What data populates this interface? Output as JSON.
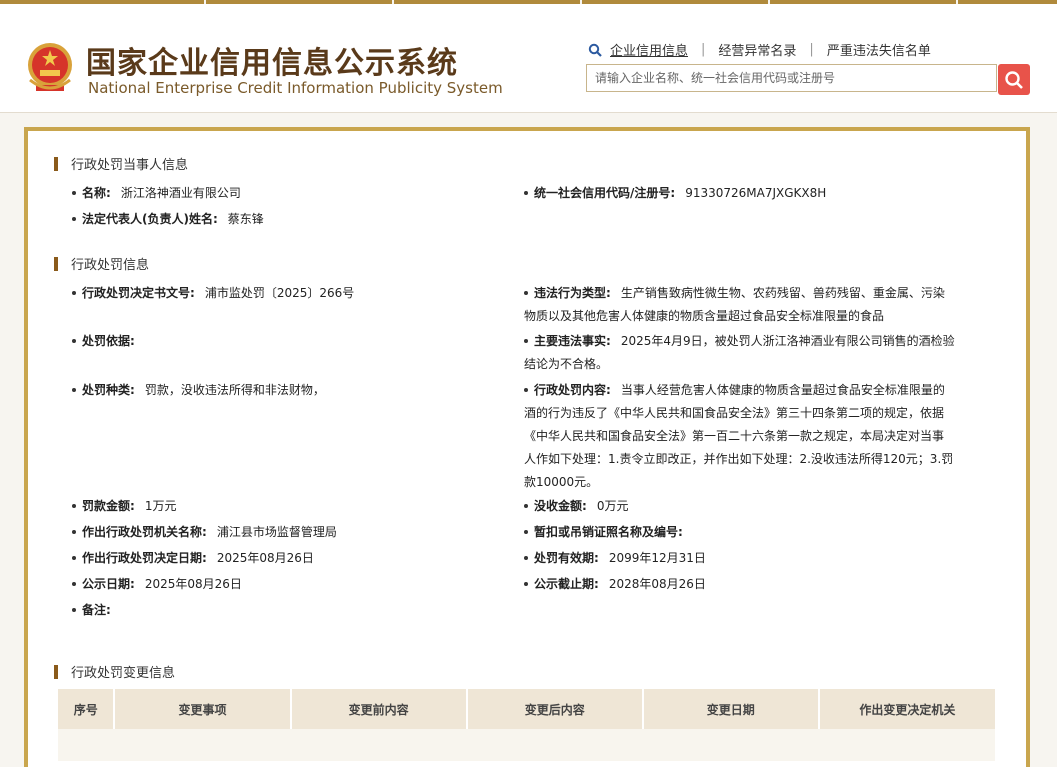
{
  "header": {
    "title_cn": "国家企业信用信息公示系统",
    "title_en": "National Enterprise Credit Information Publicity System",
    "links": [
      "企业信用信息",
      "经营异常名录",
      "严重违法失信名单"
    ],
    "search_placeholder": "请输入企业名称、统一社会信用代码或注册号",
    "icons": {
      "search_link": "search-icon",
      "search_button": "search-icon",
      "emblem": "national-emblem-icon"
    }
  },
  "party": {
    "section_title": "行政处罚当事人信息",
    "name_label": "名称:",
    "name_value": "浙江洛神酒业有限公司",
    "code_label": "统一社会信用代码/注册号:",
    "code_value": "91330726MA7JXGKX8H",
    "rep_label": "法定代表人(负责人)姓名:",
    "rep_value": "蔡东锋"
  },
  "penalty": {
    "section_title": "行政处罚信息",
    "doc_label": "行政处罚决定书文号:",
    "doc_value": "浦市监处罚〔2025〕266号",
    "vtype_label": "违法行为类型:",
    "vtype_lines": [
      "生产销售致病性微生物、农药残留、兽药残留、重金属、污染",
      "物质以及其他危害人体健康的物质含量超过食品安全标准限量的食品"
    ],
    "basis_label": "处罚依据:",
    "facts_label": "主要违法事实:",
    "facts_lines": [
      "2025年4月9日，被处罚人浙江洛神酒业有限公司销售的酒检验",
      "结论为不合格。"
    ],
    "kind_label": "处罚种类:",
    "kind_value": "罚款，没收违法所得和非法财物，",
    "content_label": "行政处罚内容:",
    "content_lines": [
      "当事人经营危害人体健康的物质含量超过食品安全标准限量的",
      "酒的行为违反了《中华人民共和国食品安全法》第三十四条第二项的规定，依据",
      "《中华人民共和国食品安全法》第一百二十六条第一款之规定，本局决定对当事",
      "人作如下处理：1.责令立即改正，并作出如下处理：2.没收违法所得120元；3.罚",
      "款10000元。"
    ],
    "fine_label": "罚款金额:",
    "fine_value": "1万元",
    "confisc_label": "没收金额:",
    "confisc_value": "0万元",
    "authority_label": "作出行政处罚机关名称:",
    "authority_value": "浦江县市场监督管理局",
    "suspend_label": "暂扣或吊销证照名称及编号:",
    "decision_date_label": "作出行政处罚决定日期:",
    "decision_date_value": "2025年08月26日",
    "valid_label": "处罚有效期:",
    "valid_value": "2099年12月31日",
    "pub_date_label": "公示日期:",
    "pub_date_value": "2025年08月26日",
    "pub_end_label": "公示截止期:",
    "pub_end_value": "2028年08月26日",
    "remark_label": "备注:"
  },
  "changes": {
    "section_title": "行政处罚变更信息",
    "columns": [
      "序号",
      "变更事项",
      "变更前内容",
      "变更后内容",
      "变更日期",
      "作出变更决定机关"
    ]
  },
  "colors": {
    "gold_border": "#c9a64e",
    "brand_brown": "#5a3a1a",
    "accent_bar": "#8a5a1a",
    "search_red": "#e8534a",
    "table_header": "#efe6d6"
  }
}
